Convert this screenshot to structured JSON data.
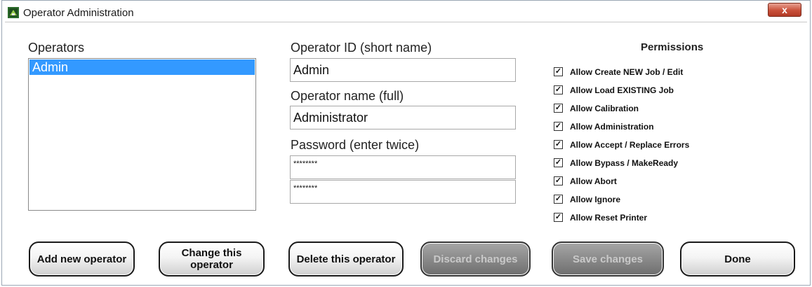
{
  "window": {
    "title": "Operator Administration",
    "close_glyph": "x"
  },
  "operators": {
    "label": "Operators",
    "items": [
      {
        "name": "Admin",
        "selected": true
      }
    ]
  },
  "fields": {
    "id_label": "Operator ID (short name)",
    "id_value": "Admin",
    "name_label": "Operator name (full)",
    "name_value": "Administrator",
    "password_label": "Password (enter twice)",
    "password1": "********",
    "password2": "********"
  },
  "permissions": {
    "title": "Permissions",
    "items": [
      {
        "label": "Allow Create NEW Job / Edit",
        "checked": true
      },
      {
        "label": "Allow Load EXISTING Job",
        "checked": true
      },
      {
        "label": "Allow Calibration",
        "checked": true
      },
      {
        "label": "Allow Administration",
        "checked": true
      },
      {
        "label": "Allow Accept / Replace Errors",
        "checked": true
      },
      {
        "label": "Allow Bypass / MakeReady",
        "checked": true
      },
      {
        "label": "Allow Abort",
        "checked": true
      },
      {
        "label": "Allow Ignore",
        "checked": true
      },
      {
        "label": "Allow Reset Printer",
        "checked": true
      }
    ]
  },
  "buttons": {
    "add": "Add new operator",
    "change": "Change this operator",
    "delete": "Delete this operator",
    "discard": "Discard changes",
    "save": "Save changes",
    "done": "Done"
  }
}
